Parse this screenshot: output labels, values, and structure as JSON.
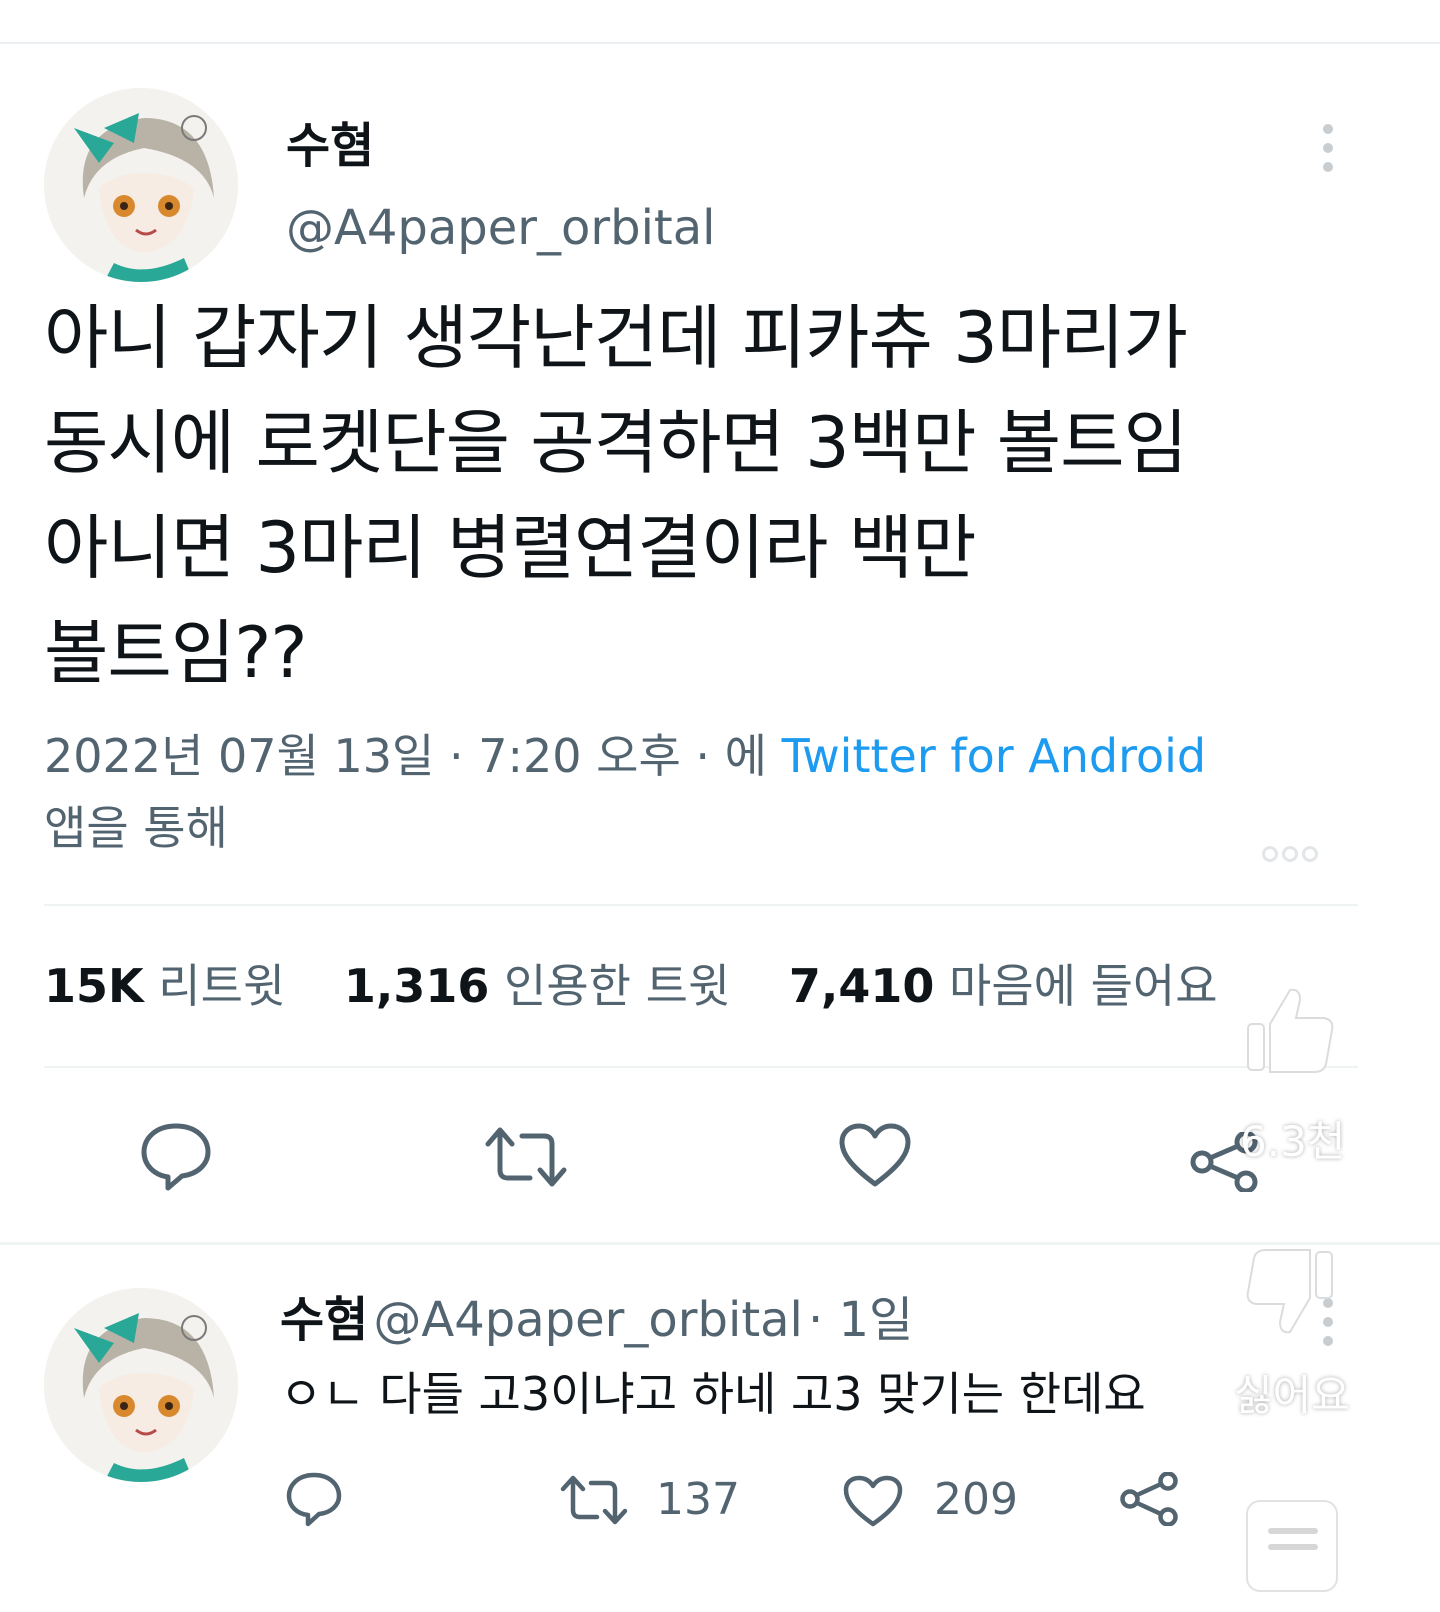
{
  "tweet": {
    "display_name": "수혐",
    "handle": "@A4paper_orbital",
    "text": "아니 갑자기 생각난건데 피카츄 3마리가\n동시에 로켓단을 공격하면 3백만 볼트임\n아니면 3마리 병렬연결이라 백만\n볼트임??",
    "timestamp": "2022년 07월 13일 · 7:20 오후 · 에",
    "source": "Twitter for Android",
    "source_suffix": "앱을 통해",
    "stats": {
      "retweets": "15K",
      "retweets_label": "리트윗",
      "quotes": "1,316",
      "quotes_label": "인용한 트윗",
      "likes": "7,410",
      "likes_label": "마음에 들어요"
    },
    "actions": [
      "reply-icon",
      "retweet-icon",
      "like-icon",
      "share-icon"
    ]
  },
  "reply": {
    "display_name": "수혐",
    "handle": "@A4paper_orbital",
    "time": "· 1일",
    "text": "ㅇㄴ 다들 고3이냐고 하네 고3 맞기는 한데요",
    "retweet_count": "137",
    "like_count": "209"
  },
  "overlay": {
    "like_count": "6.3천",
    "dislike_label": "싫어요"
  },
  "colors": {
    "link": "#1d9bf0",
    "secondary_text": "#536471",
    "primary_text": "#0f1419"
  }
}
